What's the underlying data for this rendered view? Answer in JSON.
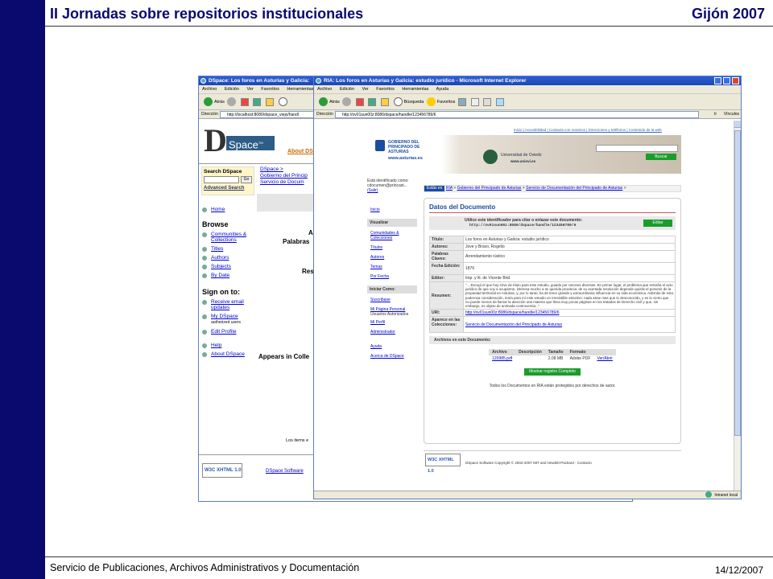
{
  "slide": {
    "title": "II Jornadas sobre repositorios institucionales",
    "location": "Gijón 2007",
    "footer": "Servicio de Publicaciones, Archivos Administrativos y Documentación",
    "date": "14/12/2007"
  },
  "dspace_window": {
    "title": "DSpace: Los foros en Asturias y Galicia:",
    "menu": [
      "Archivo",
      "Edición",
      "Ver",
      "Favoritos",
      "Herramientas"
    ],
    "back_label": "Atrás",
    "address_label": "Dirección",
    "address": "http://localhost:8080/dspace_viejo/handl",
    "logo_text": "Space",
    "logo_tm": "TM",
    "about_link": "About DS",
    "search_heading": "Search DSpace",
    "go_label": "Go",
    "advanced_search": "Advanced Search",
    "breadcrumb": [
      "DSpace >",
      "Gobierno del Princip",
      "Servicio de Docum"
    ],
    "nav_home": "Home",
    "browse_heading": "Browse",
    "browse_items": [
      "Communities & Collections",
      "Titles",
      "Authors",
      "Subjects",
      "By Date"
    ],
    "signon_heading": "Sign on to:",
    "signon_items": [
      "Receive email updates",
      "My DSpace"
    ],
    "authorized_users": "authorized users",
    "edit_profile": "Edit Profile",
    "help": "Help",
    "about_dspace": "About DSpace",
    "frag_1": "A",
    "frag_2": "Palabras",
    "frag_3": "Res",
    "appears_in": "Appears in Colle",
    "los_items": "Los items e",
    "w3c_badge": "W3C XHTML 1.0",
    "dspace_software": "DSpace Software"
  },
  "ria_window": {
    "title": "RIA: Los foros en Asturias y Galicia: estudio jurídico - Microsoft Internet Explorer",
    "menu": [
      "Archivo",
      "Edición",
      "Ver",
      "Favoritos",
      "Herramientas",
      "Ayuda"
    ],
    "back_label": "Atrás",
    "search_label": "Búsqueda",
    "favorites_label": "Favoritos",
    "address_label": "Dirección",
    "address": "http://ov01sun00z:8086/dspace/handle/123456789/6",
    "go_label": "Ir",
    "links_label": "Vínculos",
    "top_links": "Inicio | Accesibilidad | Contacta con nosotros | Direcciones y teléfonos | Contenido de la web",
    "gov_name": "GOBIERNO DEL PRINCIPADO DE ASTURIAS",
    "gov_url": "www.asturias.es",
    "uni_name": "Universidad de Oviedo",
    "uni_url": "www.uniovi.es",
    "search_button": "Buscar",
    "identified_as": "Está identificado como:",
    "user": "cdocumen@princast...",
    "logout": "(Salir)",
    "estas_en": "Estás en",
    "breadcrumb": [
      "RIA",
      "Gobierno del Principado de Asturias",
      "Servicio de Documentación del Principado de Asturias"
    ],
    "nav_inicio": "Inicio",
    "visualizar": "Visualizar",
    "nav_items": [
      "Comunidades & Colecciones",
      "Títulos",
      "Autores",
      "Temas",
      "Por Fecha"
    ],
    "iniciar_como": "Iniciar Como:",
    "nav_items_2": [
      "Suscribase",
      "Mi Página Personal",
      "Mi Perfil",
      "Administrador"
    ],
    "usuarios_autorizados": "Usuarios Autorizados",
    "nav_items_3": [
      "Ayuda",
      "Acerca de DSpace"
    ],
    "datos_title": "Datos del Documento",
    "identifier_text": "Utilice este identificador para citar o enlazar este documento:",
    "identifier_url": "http://ov01sun00z:8086/dspace/handle/123456789/6",
    "edit_button": "Editar",
    "fields": [
      {
        "label": "Título:",
        "value": "Los foros en Asturias y Galicia: estudio jurídico"
      },
      {
        "label": "Autores:",
        "value": "Jove y Bravo, Rogelio"
      },
      {
        "label": "Palabras Claves:",
        "value": "Arrendamiento rústico"
      },
      {
        "label": "Fecha Edición:",
        "value": "1876"
      },
      {
        "label": "Editor:",
        "value": "Imp. y lit. de Vicente Brid"
      },
      {
        "label": "Resumen:",
        "value": "\"... Escogí el que hoy sirve de título para este estudio, guiado por razones diversas. En primer lugar, el problema que entraña el acto jurídico de que voy a ocuparme, interesa mucho a mi querida provincia: de su acertada resolución depende quizás el porvenir de la propiedad territorial en Asturias, y, por lo tanto, ha de tener grande y extraordinaria influencia en su vida económica. Además de esta poderosa consideración, tenía para mí este estudio un irresistible atractivo: nada atrae mas que lo desconocido, y es lo cierto que no puede menos de llamar la atención una materia que lleva muy pocas páginas en los tratados de Derecho civil y que, sin embargo, es objeto de animada controversia...\""
      },
      {
        "label": "URI:",
        "value": "http://ov01sun00z:8086/dspace/handle/123456789/6"
      },
      {
        "label": "Aparece en las Colecciones:",
        "value": "Servicio de Documentación del Principado de Asturias"
      }
    ],
    "files_header": "Archivos en este Documento:",
    "file_cols": [
      "Archivo",
      "Descripción",
      "Tamaño",
      "Formato"
    ],
    "file_row": [
      "120985.pdf",
      "",
      "2.08 MB",
      "Adobe PDF",
      "Ver/Abrir"
    ],
    "full_record_button": "Mostrar registro Completo",
    "rights": "Todos los Documentos en RIA están protegidos por derechos de autor.",
    "w3c_badge": "W3C XHTML 1.0",
    "footer_text": "DSpace Software  Copyright © 2002-2007  MIT  and  Hewlett-Packard  -  Contacto",
    "status_zone": "Intranet local"
  },
  "colors": {
    "slide_blue": "#0a0a6e",
    "ie_title": "#1c45b3",
    "green": "#1a9d2a"
  }
}
